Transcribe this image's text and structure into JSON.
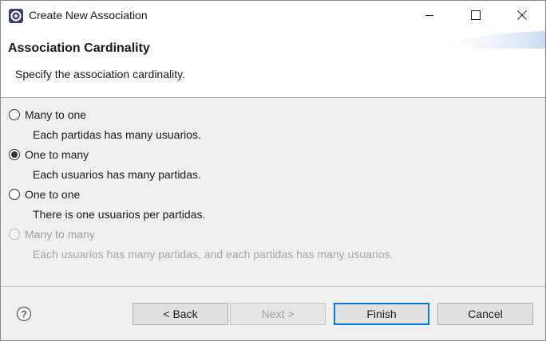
{
  "window": {
    "title": "Create New Association",
    "controls": {
      "minimize_icon": "minimize-icon",
      "maximize_icon": "maximize-icon",
      "close_icon": "close-icon"
    }
  },
  "header": {
    "title": "Association Cardinality",
    "description": "Specify the association cardinality."
  },
  "options": [
    {
      "label": "Many to one",
      "description": "Each partidas has many usuarios.",
      "checked": false,
      "enabled": true
    },
    {
      "label": "One to many",
      "description": "Each usuarios has many partidas.",
      "checked": true,
      "enabled": true
    },
    {
      "label": "One to one",
      "description": "There is one usuarios per partidas.",
      "checked": false,
      "enabled": true
    },
    {
      "label": "Many to many",
      "description": "Each usuarios has many partidas, and each partidas has many usuarios.",
      "checked": false,
      "enabled": false
    }
  ],
  "buttons": {
    "back": "< Back",
    "next": "Next >",
    "finish": "Finish",
    "cancel": "Cancel"
  },
  "colors": {
    "accent": "#0078d7",
    "banner": "#c9dcf2"
  }
}
